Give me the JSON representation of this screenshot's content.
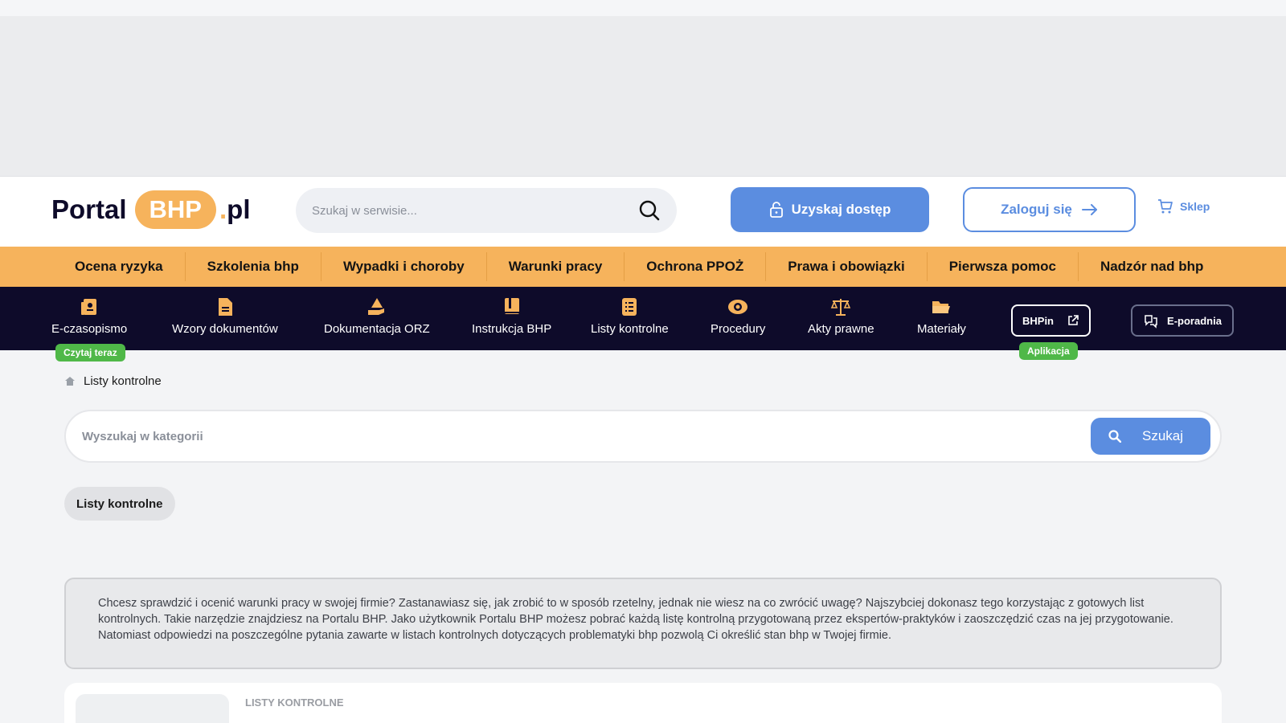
{
  "header": {
    "logo": {
      "word": "Portal",
      "pill": "BHP",
      "dot": ".",
      "tld": "pl"
    },
    "search_placeholder": "Szukaj w serwisie...",
    "access_button": "Uzyskaj dostęp",
    "login_button": "Zaloguj się",
    "shop_link": "Sklep"
  },
  "nav_main": [
    "Ocena ryzyka",
    "Szkolenia bhp",
    "Wypadki i choroby",
    "Warunki pracy",
    "Ochrona PPOŻ",
    "Prawa i obowiązki",
    "Pierwsza pomoc",
    "Nadzór nad bhp"
  ],
  "nav_secondary": [
    {
      "label": "E-czasopismo",
      "icon": "magazine-icon"
    },
    {
      "label": "Wzory dokumentów",
      "icon": "document-icon"
    },
    {
      "label": "Dokumentacja ORZ",
      "icon": "hand-icon"
    },
    {
      "label": "Instrukcja BHP",
      "icon": "book-icon"
    },
    {
      "label": "Listy kontrolne",
      "icon": "checklist-icon"
    },
    {
      "label": "Procedury",
      "icon": "eye-icon"
    },
    {
      "label": "Akty prawne",
      "icon": "scales-icon"
    },
    {
      "label": "Materiały",
      "icon": "folder-icon"
    }
  ],
  "badges": {
    "read_now": "Czytaj teraz",
    "app": "Aplikacja"
  },
  "bhpin_button": "BHPin",
  "eporadnia_button": "E-poradnia",
  "breadcrumb": {
    "current": "Listy kontrolne"
  },
  "category_search": {
    "placeholder": "Wyszukaj w kategorii",
    "button": "Szukaj"
  },
  "category_tag": "Listy kontrolne",
  "intro_text": "Chcesz sprawdzić i ocenić warunki pracy w swojej firmie? Zastanawiasz się, jak zrobić to w sposób rzetelny, jednak nie wiesz na co zwrócić uwagę? Najszybciej dokonasz tego korzystając z gotowych list kontrolnych. Takie narzędzie znajdziesz na Portalu BHP. Jako użytkownik Portalu BHP możesz pobrać każdą listę kontrolną przygotowaną przez ekspertów-praktyków i zaoszczędzić czas na jej przygotowanie. Natomiast odpowiedzi na poszczególne pytania zawarte w listach kontrolnych dotyczących problematyki bhp pozwolą Ci określić stan bhp w Twojej firmie.",
  "card": {
    "kicker": "LISTY KONTROLNE"
  },
  "colors": {
    "accent_blue": "#5b8de0",
    "orange": "#f6b35c",
    "navy": "#0e0b2a",
    "green": "#4fb848"
  }
}
